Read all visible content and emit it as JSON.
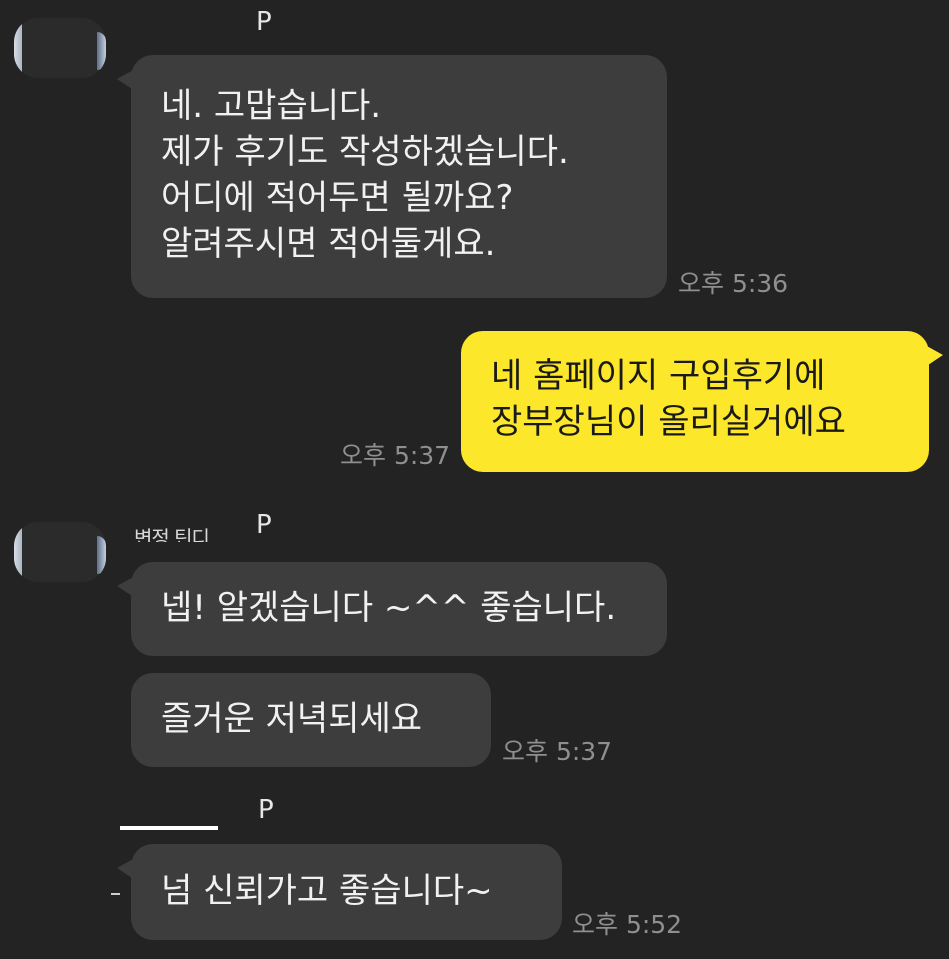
{
  "chat": {
    "groups": [
      {
        "sender": "P",
        "messages": [
          {
            "text": "네. 고맙습니다.\n제가 후기도 작성하겠습니다.\n어디에 적어두면 될까요?\n알려주시면 적어둘게요.",
            "time": "오후 5:36"
          }
        ]
      },
      {
        "mine": true,
        "messages": [
          {
            "text": "네 홈페이지 구입후기에\n장부장님이 올리실거에요",
            "time": "오후 5:37"
          }
        ]
      },
      {
        "sender": "P",
        "sender_prefix": "변정 틴디",
        "messages": [
          {
            "text": "넵! 알겠습니다 ~^^ 좋습니다."
          },
          {
            "text": "즐거운 저녁되세요",
            "time": "오후 5:37"
          }
        ]
      },
      {
        "sender": "P",
        "messages": [
          {
            "text": "넘 신뢰가고 좋습니다~",
            "time": "오후 5:52"
          }
        ]
      }
    ]
  },
  "colors": {
    "background": "#232323",
    "incoming_bubble": "#3d3d3d",
    "outgoing_bubble": "#fde72b",
    "time_text": "#8f8f8f"
  }
}
